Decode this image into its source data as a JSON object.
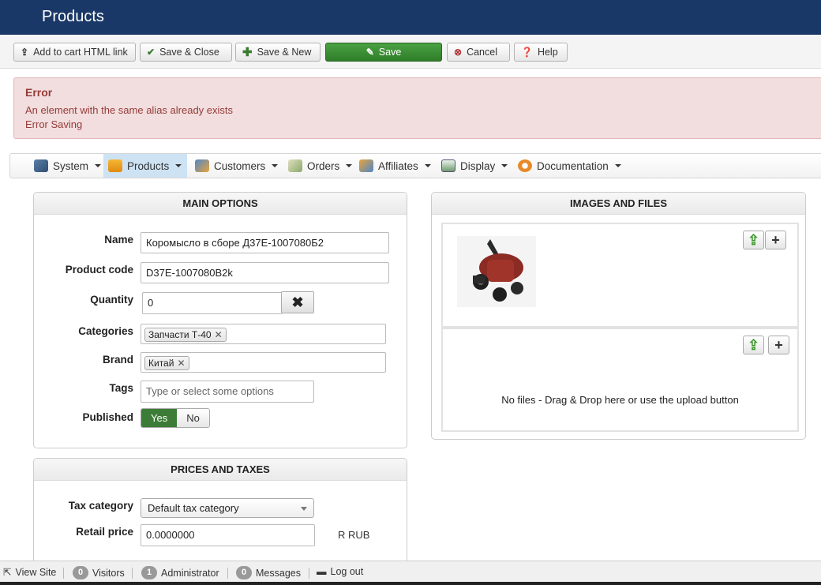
{
  "header": {
    "title": "Products"
  },
  "toolbar": {
    "add_cart_link": "Add to cart HTML link",
    "save_close": "Save & Close",
    "save_new": "Save & New",
    "save": "Save",
    "cancel": "Cancel",
    "help": "Help"
  },
  "alert": {
    "heading": "Error",
    "line1": "An element with the same alias already exists",
    "line2": "Error Saving"
  },
  "nav": {
    "items": [
      {
        "label": "System",
        "icon": "tools-icon"
      },
      {
        "label": "Products",
        "icon": "box-icon"
      },
      {
        "label": "Customers",
        "icon": "users-icon"
      },
      {
        "label": "Orders",
        "icon": "orders-icon"
      },
      {
        "label": "Affiliates",
        "icon": "affiliates-icon"
      },
      {
        "label": "Display",
        "icon": "display-icon"
      },
      {
        "label": "Documentation",
        "icon": "lifebuoy-icon"
      }
    ],
    "active": "Products"
  },
  "main_options": {
    "title": "MAIN OPTIONS",
    "name_label": "Name",
    "name_value": "Коромысло в сборе Д37Е-1007080Б2",
    "code_label": "Product code",
    "code_value": "D37E-1007080B2k",
    "quantity_label": "Quantity",
    "quantity_value": "0",
    "quantity_clear": "✖",
    "categories_label": "Categories",
    "category_tag": "Запчасти Т-40",
    "brand_label": "Brand",
    "brand_tag": "Китай",
    "tags_label": "Tags",
    "tags_placeholder": "Type or select some options",
    "published_label": "Published",
    "published_yes": "Yes",
    "published_no": "No",
    "published_value": "Yes"
  },
  "prices": {
    "title": "PRICES AND TAXES",
    "tax_label": "Tax category",
    "tax_value": "Default tax category",
    "retail_label": "Retail price",
    "retail_value": "0.0000000",
    "currency": "R RUB"
  },
  "images": {
    "title": "IMAGES AND FILES",
    "files_empty": "No files - Drag & Drop here or use the upload button"
  },
  "statusbar": {
    "view_site": "View Site",
    "visitors_count": "0",
    "visitors": "Visitors",
    "admin_count": "1",
    "admin": "Administrator",
    "messages_count": "0",
    "messages": "Messages",
    "logout": "Log out"
  }
}
